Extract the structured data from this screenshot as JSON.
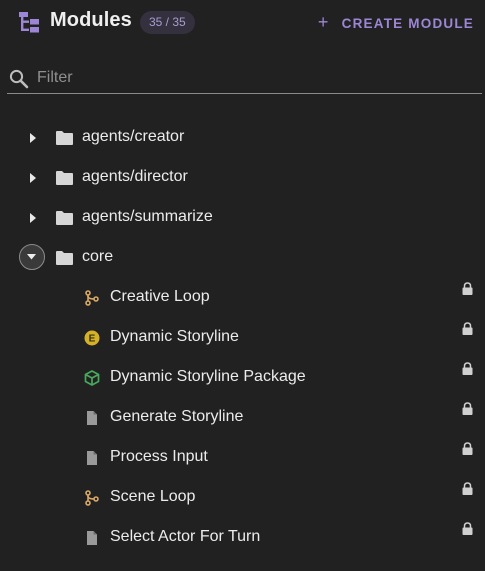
{
  "header": {
    "title": "Modules",
    "count": "35 / 35",
    "create_label": "CREATE MODULE",
    "plus_glyph": "+"
  },
  "filter": {
    "placeholder": "Filter",
    "value": ""
  },
  "colors": {
    "background": "#212121",
    "accent": "#9e86d6",
    "badge_bg": "#34303d",
    "flow_icon": "#d9a766",
    "event_icon": "#d4b12a",
    "package_icon": "#49a85c"
  },
  "tree": {
    "folders": [
      {
        "label": "agents/creator",
        "expanded": false,
        "icon": "folder-icon"
      },
      {
        "label": "agents/director",
        "expanded": false,
        "icon": "folder-icon"
      },
      {
        "label": "agents/summarize",
        "expanded": false,
        "icon": "folder-icon"
      },
      {
        "label": "core",
        "expanded": true,
        "icon": "folder-icon"
      }
    ],
    "core_items": [
      {
        "label": "Creative Loop",
        "icon": "flow-icon",
        "locked": true
      },
      {
        "label": "Dynamic Storyline",
        "icon": "event-icon",
        "locked": true
      },
      {
        "label": "Dynamic Storyline Package",
        "icon": "package-icon",
        "locked": true
      },
      {
        "label": "Generate Storyline",
        "icon": "file-icon",
        "locked": true
      },
      {
        "label": "Process Input",
        "icon": "file-icon",
        "locked": true
      },
      {
        "label": "Scene Loop",
        "icon": "flow-icon",
        "locked": true
      },
      {
        "label": "Select Actor For Turn",
        "icon": "file-icon",
        "locked": true
      }
    ]
  }
}
